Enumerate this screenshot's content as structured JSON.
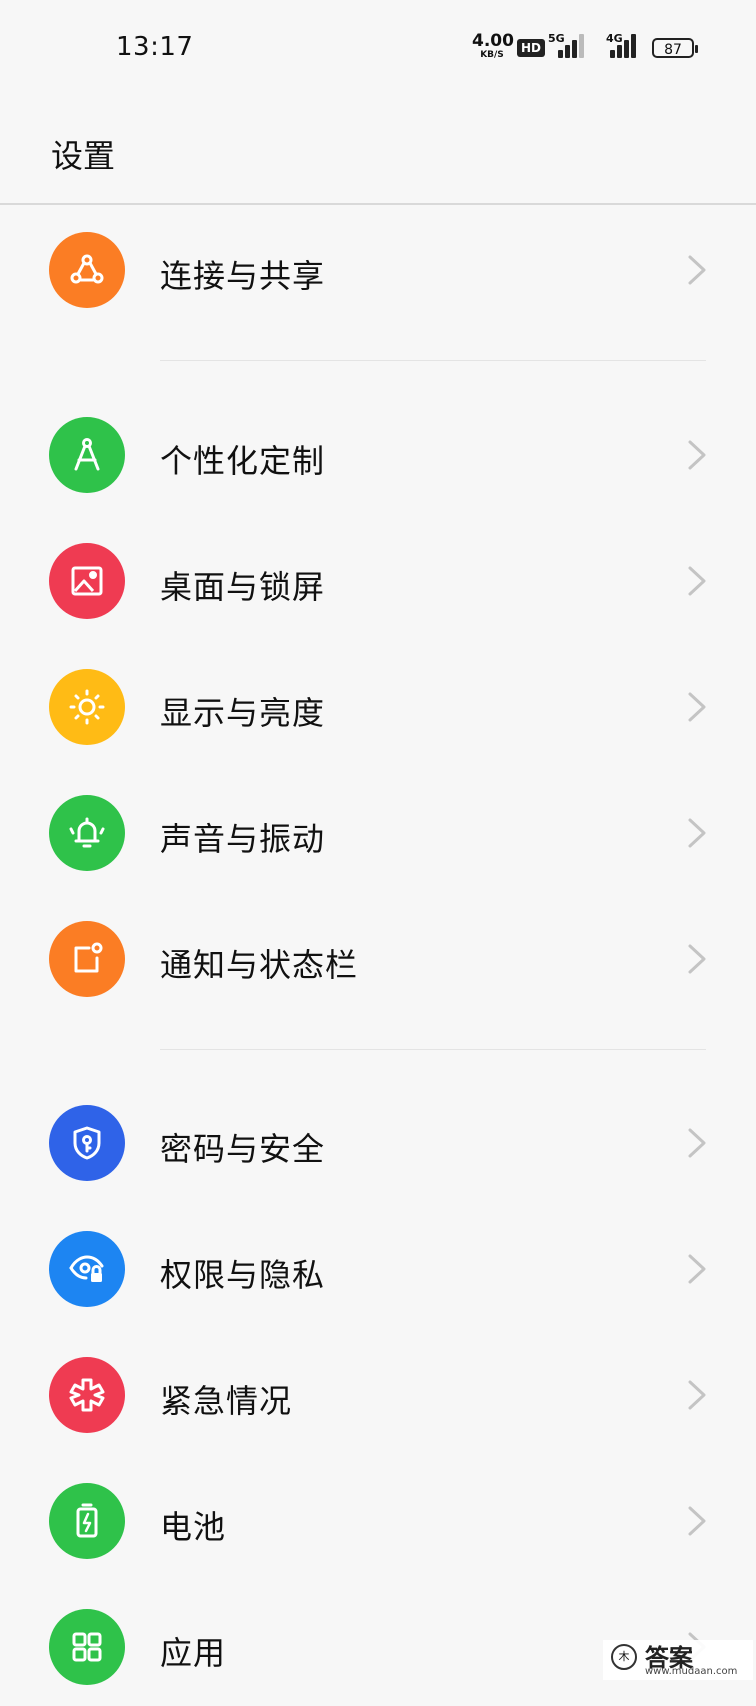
{
  "status_bar": {
    "time": "13:17",
    "net_speed": "4.00",
    "net_unit": "KB/S",
    "hd_badge": "HD",
    "sim1_label": "5G",
    "sim2_label": "4G",
    "battery": "87"
  },
  "header": {
    "title": "设置"
  },
  "menu": {
    "items": [
      {
        "label": "连接与共享",
        "icon": "share-network-icon",
        "color": "#fb7d24"
      },
      {
        "label": "个性化定制",
        "icon": "compass-icon",
        "color": "#2fc24a"
      },
      {
        "label": "桌面与锁屏",
        "icon": "wallpaper-image-icon",
        "color": "#ef3b52"
      },
      {
        "label": "显示与亮度",
        "icon": "brightness-sun-icon",
        "color": "#ffbb15"
      },
      {
        "label": "声音与振动",
        "icon": "bell-vibrate-icon",
        "color": "#2fc24a"
      },
      {
        "label": "通知与状态栏",
        "icon": "notification-icon",
        "color": "#fb7d24"
      },
      {
        "label": "密码与安全",
        "icon": "shield-key-icon",
        "color": "#2f63e8"
      },
      {
        "label": "权限与隐私",
        "icon": "eye-lock-icon",
        "color": "#1d85f2"
      },
      {
        "label": "紧急情况",
        "icon": "emergency-asterisk-icon",
        "color": "#ef3b52"
      },
      {
        "label": "电池",
        "icon": "battery-charge-icon",
        "color": "#2fc24a"
      },
      {
        "label": "应用",
        "icon": "apps-grid-icon",
        "color": "#2fc24a"
      }
    ]
  },
  "watermark": {
    "text": "答案",
    "sub": "www.mudaan.com",
    "logo": "木"
  }
}
